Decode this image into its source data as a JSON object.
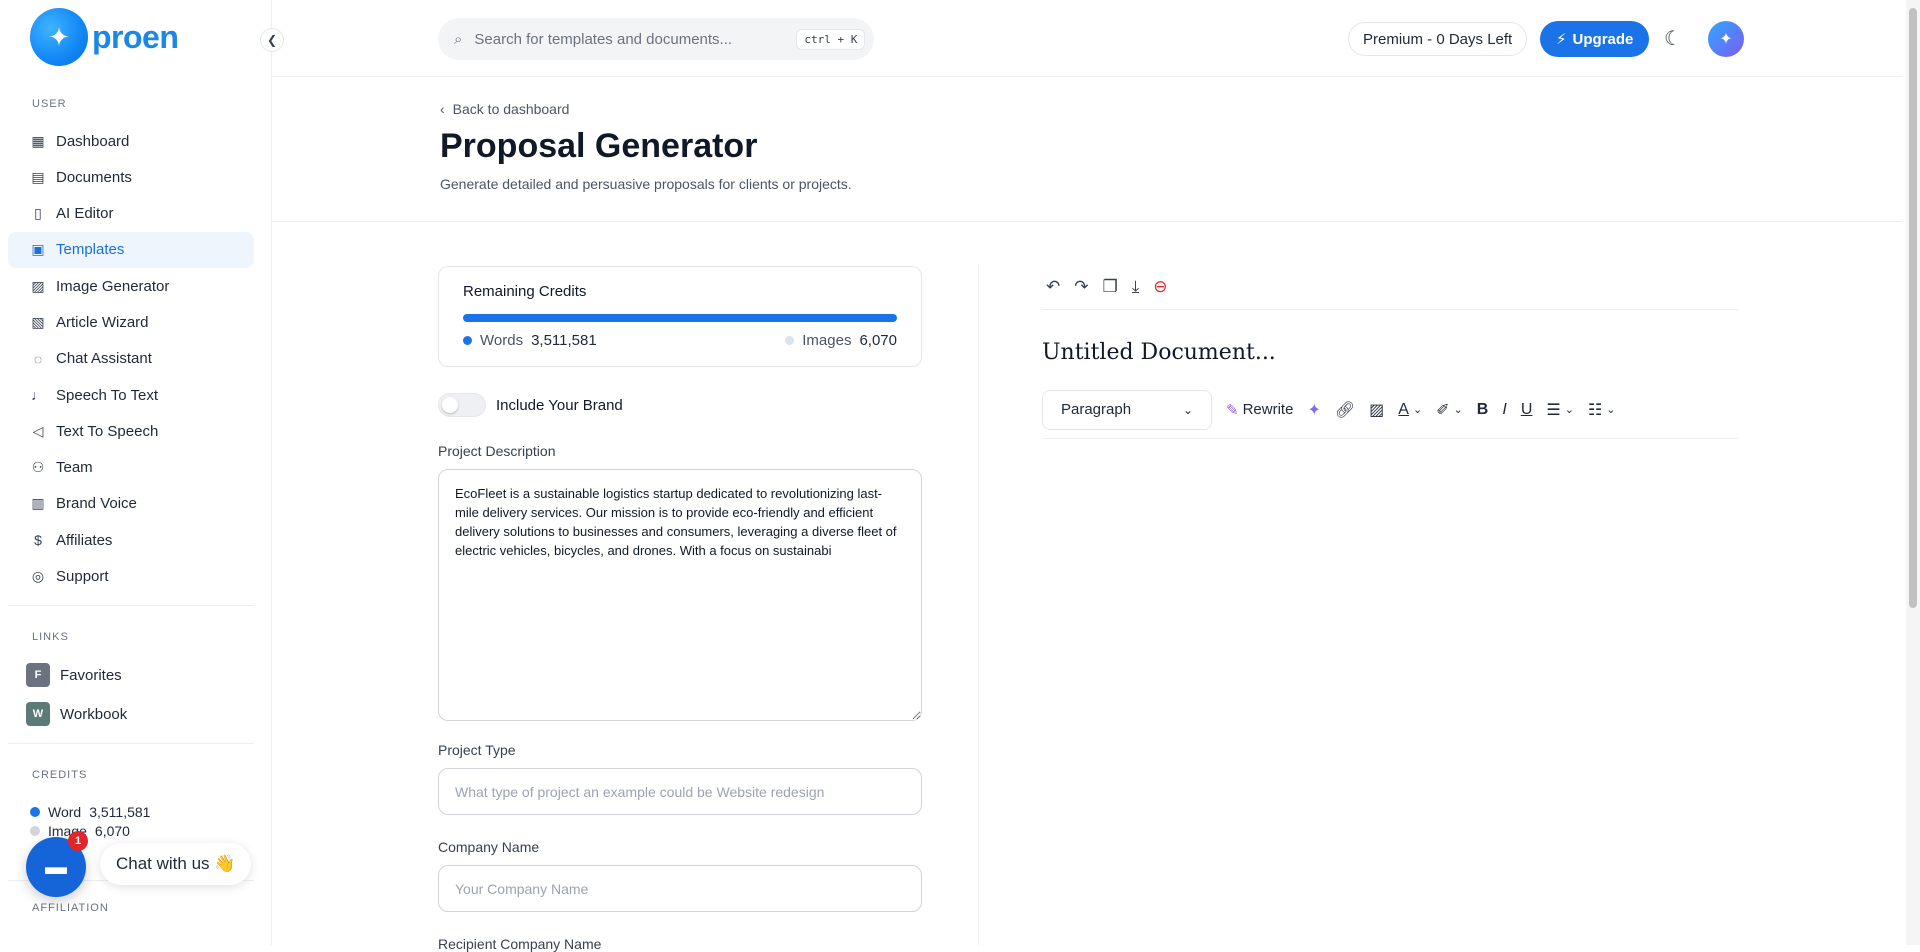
{
  "app": {
    "logo_text": "proen"
  },
  "sidebar": {
    "user_section": "USER",
    "items": [
      {
        "label": "Dashboard",
        "icon": "▦"
      },
      {
        "label": "Documents",
        "icon": "▤"
      },
      {
        "label": "AI Editor",
        "icon": "▯"
      },
      {
        "label": "Templates",
        "icon": "▣"
      },
      {
        "label": "Image Generator",
        "icon": "▨"
      },
      {
        "label": "Article Wizard",
        "icon": "▧"
      },
      {
        "label": "Chat Assistant",
        "icon": "◌"
      },
      {
        "label": "Speech To Text",
        "icon": "♩"
      },
      {
        "label": "Text To Speech",
        "icon": "◁"
      },
      {
        "label": "Team",
        "icon": "⚇"
      },
      {
        "label": "Brand Voice",
        "icon": "▥"
      },
      {
        "label": "Affiliates",
        "icon": "$"
      },
      {
        "label": "Support",
        "icon": "◎"
      }
    ],
    "links_section": "LINKS",
    "links": [
      {
        "badge": "F",
        "label": "Favorites",
        "color": "#6b7280"
      },
      {
        "badge": "W",
        "label": "Workbook",
        "color": "#5b7a78"
      }
    ],
    "credits_section": "CREDITS",
    "credits": [
      {
        "label": "Word",
        "value": "3,511,581",
        "color": "#1b73e8"
      },
      {
        "label": "Image",
        "value": "6,070",
        "color": "#d1d5db"
      }
    ],
    "affiliation_section": "AFFILIATION"
  },
  "chat": {
    "count": "1",
    "label": "Chat with us 👋"
  },
  "topbar": {
    "search_placeholder": "Search for templates and documents...",
    "shortcut": "ctrl + K",
    "premium": "Premium - 0 Days Left",
    "upgrade": "Upgrade"
  },
  "header": {
    "back": "Back to dashboard",
    "title": "Proposal Generator",
    "description": "Generate detailed and persuasive proposals for clients or projects."
  },
  "form": {
    "credits_title": "Remaining Credits",
    "credits_progress_pct": 100,
    "words_label": "Words",
    "words_value": "3,511,581",
    "images_label": "Images",
    "images_value": "6,070",
    "brand_toggle_label": "Include Your Brand",
    "project_description_label": "Project Description",
    "project_description_value": "EcoFleet is a sustainable logistics startup dedicated to revolutionizing last-mile delivery services. Our mission is to provide eco-friendly and efficient delivery solutions to businesses and consumers, leveraging a diverse fleet of electric vehicles, bicycles, and drones. With a focus on sustainabi",
    "project_type_label": "Project Type",
    "project_type_placeholder": "What type of project an example could be Website redesign",
    "company_name_label": "Company Name",
    "company_name_placeholder": "Your Company Name",
    "recipient_label": "Recipient Company Name"
  },
  "editor": {
    "doc_title": "Untitled Document...",
    "block_type": "Paragraph",
    "rewrite": "Rewrite"
  },
  "colors": {
    "accent": "#1b73e8",
    "danger": "#e0262d"
  }
}
